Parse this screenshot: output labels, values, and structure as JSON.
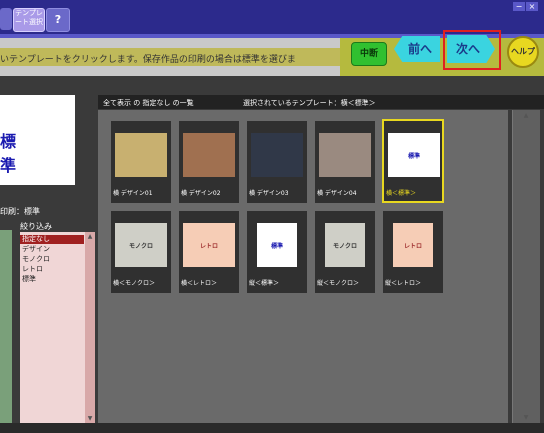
{
  "window": {
    "minimize": "−",
    "close": "×"
  },
  "tabs": {
    "template_select": "テンプレート選択",
    "help": "?"
  },
  "instruction": "いテンプレートをクリックします。保存作品の印刷の場合は標準を選びま",
  "nav": {
    "interrupt": "中断",
    "back": "前へ",
    "next": "次へ",
    "help": "ヘルプ"
  },
  "preview": {
    "text": "標準",
    "print_label": "印刷：標準"
  },
  "filter": {
    "label": "絞り込み",
    "items": [
      "指定なし",
      "デザイン",
      "モノクロ",
      "レトロ",
      "標準"
    ],
    "selected": "指定なし"
  },
  "main": {
    "list_label": "全て表示 の 指定なし の一覧",
    "selected_label": "選択されているテンプレート：横＜標準＞"
  },
  "cards": [
    {
      "name": "横 デザイン01",
      "thumb_text": "",
      "color": "#c8b070"
    },
    {
      "name": "横 デザイン02",
      "thumb_text": "",
      "color": "#a07050"
    },
    {
      "name": "横 デザイン03",
      "thumb_text": "",
      "color": "#303848"
    },
    {
      "name": "横 デザイン04",
      "thumb_text": "",
      "color": "#9a8a80"
    },
    {
      "name": "横＜標準＞",
      "thumb_text": "標準",
      "color": "#ffffff"
    },
    {
      "name": "横＜モノクロ＞",
      "thumb_text": "モノクロ",
      "color": "#cfcfc7"
    },
    {
      "name": "横＜レトロ＞",
      "thumb_text": "レトロ",
      "color": "#f6cdb6"
    },
    {
      "name": "縦＜標準＞",
      "thumb_text": "標準",
      "color": "#ffffff"
    },
    {
      "name": "縦＜モノクロ＞",
      "thumb_text": "モノクロ",
      "color": "#cfcfc7"
    },
    {
      "name": "縦＜レトロ＞",
      "thumb_text": "レトロ",
      "color": "#f6cdb6"
    }
  ],
  "colors": {
    "title_bar": "#2c2a8c",
    "nav_area": "#b5ba3e",
    "highlight": "#e02020",
    "selected_card_border": "#e8d820"
  }
}
